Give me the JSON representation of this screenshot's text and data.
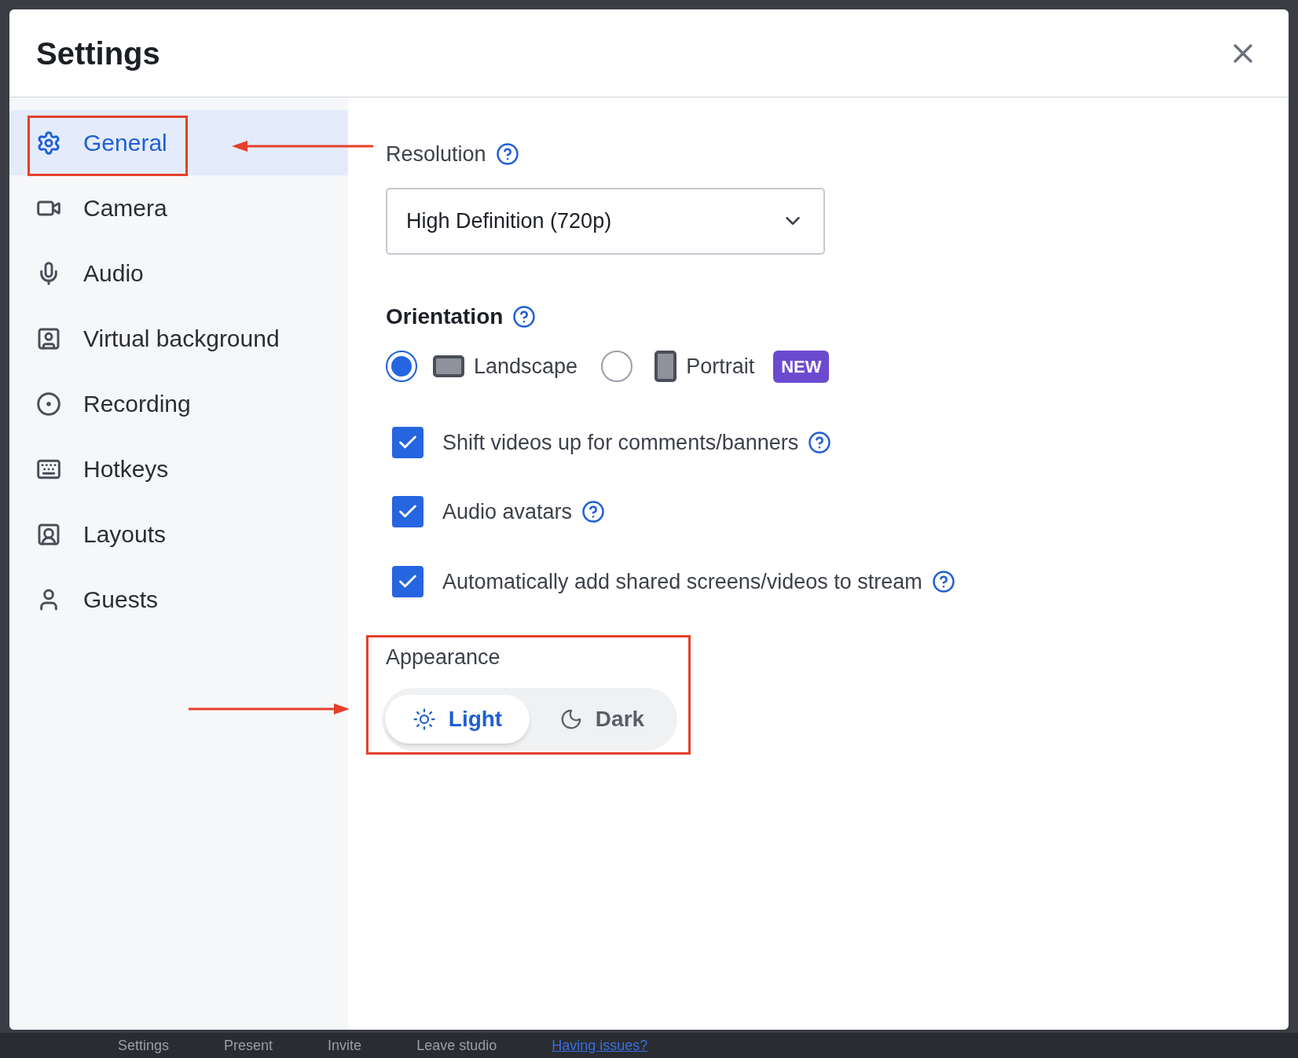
{
  "dialog": {
    "title": "Settings"
  },
  "sidebar": {
    "items": [
      {
        "label": "General",
        "selected": true
      },
      {
        "label": "Camera",
        "selected": false
      },
      {
        "label": "Audio",
        "selected": false
      },
      {
        "label": "Virtual background",
        "selected": false
      },
      {
        "label": "Recording",
        "selected": false
      },
      {
        "label": "Hotkeys",
        "selected": false
      },
      {
        "label": "Layouts",
        "selected": false
      },
      {
        "label": "Guests",
        "selected": false
      }
    ]
  },
  "resolution": {
    "label": "Resolution",
    "value": "High Definition (720p)"
  },
  "orientation": {
    "label": "Orientation",
    "options": [
      {
        "label": "Landscape",
        "selected": true
      },
      {
        "label": "Portrait",
        "selected": false,
        "badge": "NEW"
      }
    ]
  },
  "checkboxes": [
    {
      "label": "Shift videos up for comments/banners",
      "checked": true
    },
    {
      "label": "Audio avatars",
      "checked": true
    },
    {
      "label": "Automatically add shared screens/videos to stream",
      "checked": true
    }
  ],
  "appearance": {
    "label": "Appearance",
    "options": [
      {
        "label": "Light",
        "selected": true
      },
      {
        "label": "Dark",
        "selected": false
      }
    ]
  },
  "background_bar": {
    "items": [
      "Settings",
      "Present",
      "Invite",
      "Leave studio"
    ],
    "link": "Having issues?"
  }
}
